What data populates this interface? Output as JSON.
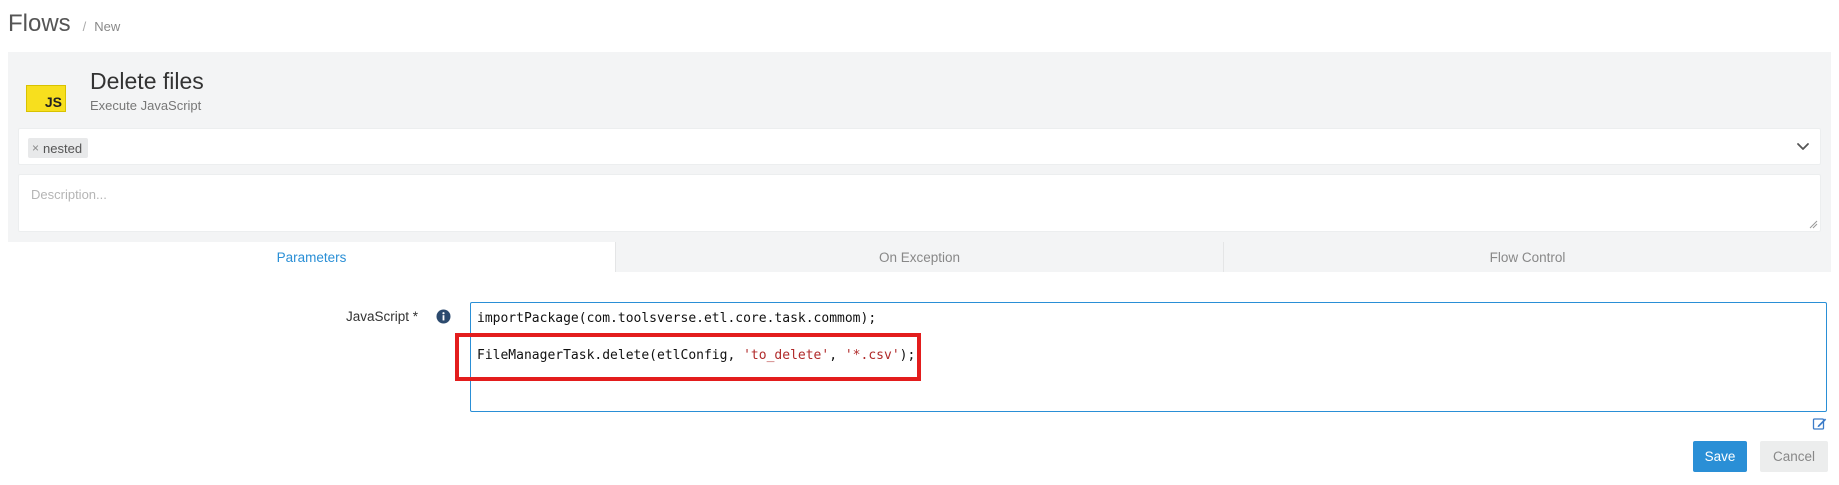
{
  "breadcrumb": {
    "title": "Flows",
    "separator": "/",
    "current": "New"
  },
  "task": {
    "logo_text": "JS",
    "name": "Delete files",
    "type": "Execute JavaScript",
    "logo_color": "#f7df1e"
  },
  "tags": {
    "items": [
      {
        "remove": "×",
        "label": "nested"
      }
    ]
  },
  "description": {
    "placeholder": "Description..."
  },
  "tabs": [
    {
      "label": "Parameters",
      "active": true
    },
    {
      "label": "On Exception",
      "active": false
    },
    {
      "label": "Flow Control",
      "active": false
    }
  ],
  "form": {
    "javascript_label": "JavaScript *",
    "code": {
      "line1": "importPackage(com.toolsverse.etl.core.task.commom);",
      "line2_prefix": "FileManagerTask.delete(etlConfig, ",
      "line2_arg1": "'to_delete'",
      "line2_sep": ", ",
      "line2_arg2": "'*.csv'",
      "line2_suffix": ");"
    }
  },
  "actions": {
    "save_label": "Save",
    "cancel_label": "Cancel"
  },
  "colors": {
    "accent": "#2a8fd6",
    "highlight": "#e31d1d",
    "string": "#b02a2a"
  }
}
